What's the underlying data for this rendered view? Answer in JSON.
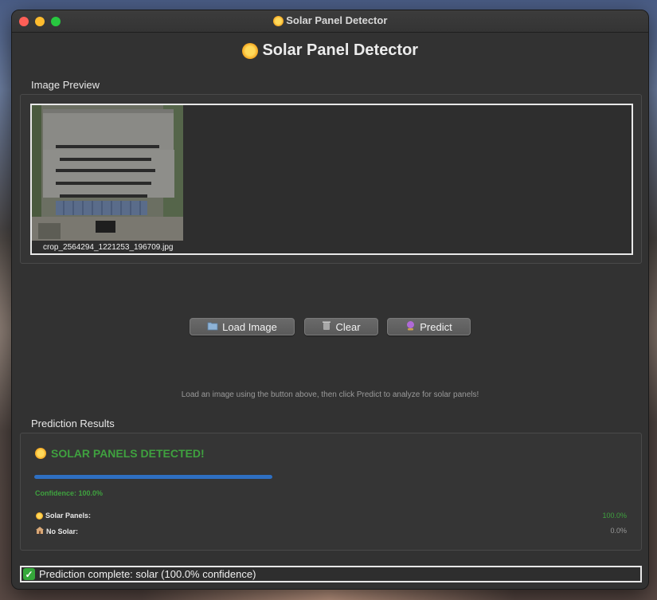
{
  "window": {
    "titlebar_title": "Solar Panel Detector"
  },
  "app": {
    "title": "Solar Panel Detector",
    "title_icon": "sun-icon"
  },
  "preview": {
    "section_label": "Image Preview",
    "filename": "crop_2564294_1221253_196709.jpg"
  },
  "toolbar": {
    "load_label": "Load Image",
    "load_icon": "folder-icon",
    "clear_label": "Clear",
    "clear_icon": "trash-icon",
    "predict_label": "Predict",
    "predict_icon": "crystal-ball-icon"
  },
  "hint": "Load an image using the button above, then click Predict to analyze for solar panels!",
  "results": {
    "section_label": "Prediction Results",
    "heading": "SOLAR PANELS DETECTED!",
    "heading_icon": "sun-icon",
    "confidence_text": "Confidence: 100.0%",
    "confidence_fraction": 1.0,
    "rows": [
      {
        "label": "Solar Panels:",
        "icon": "sun-icon",
        "value": "100.0%",
        "color": "#3fa13f"
      },
      {
        "label": "No Solar:",
        "icon": "house-icon",
        "value": "0.0%",
        "color": "#9a9a9a"
      }
    ]
  },
  "status": {
    "text": "Prediction complete: solar (100.0% confidence)",
    "icon": "checkmark-icon"
  },
  "colors": {
    "success": "#3fa13f",
    "progress": "#2e6fc2",
    "window_bg": "#323232"
  }
}
